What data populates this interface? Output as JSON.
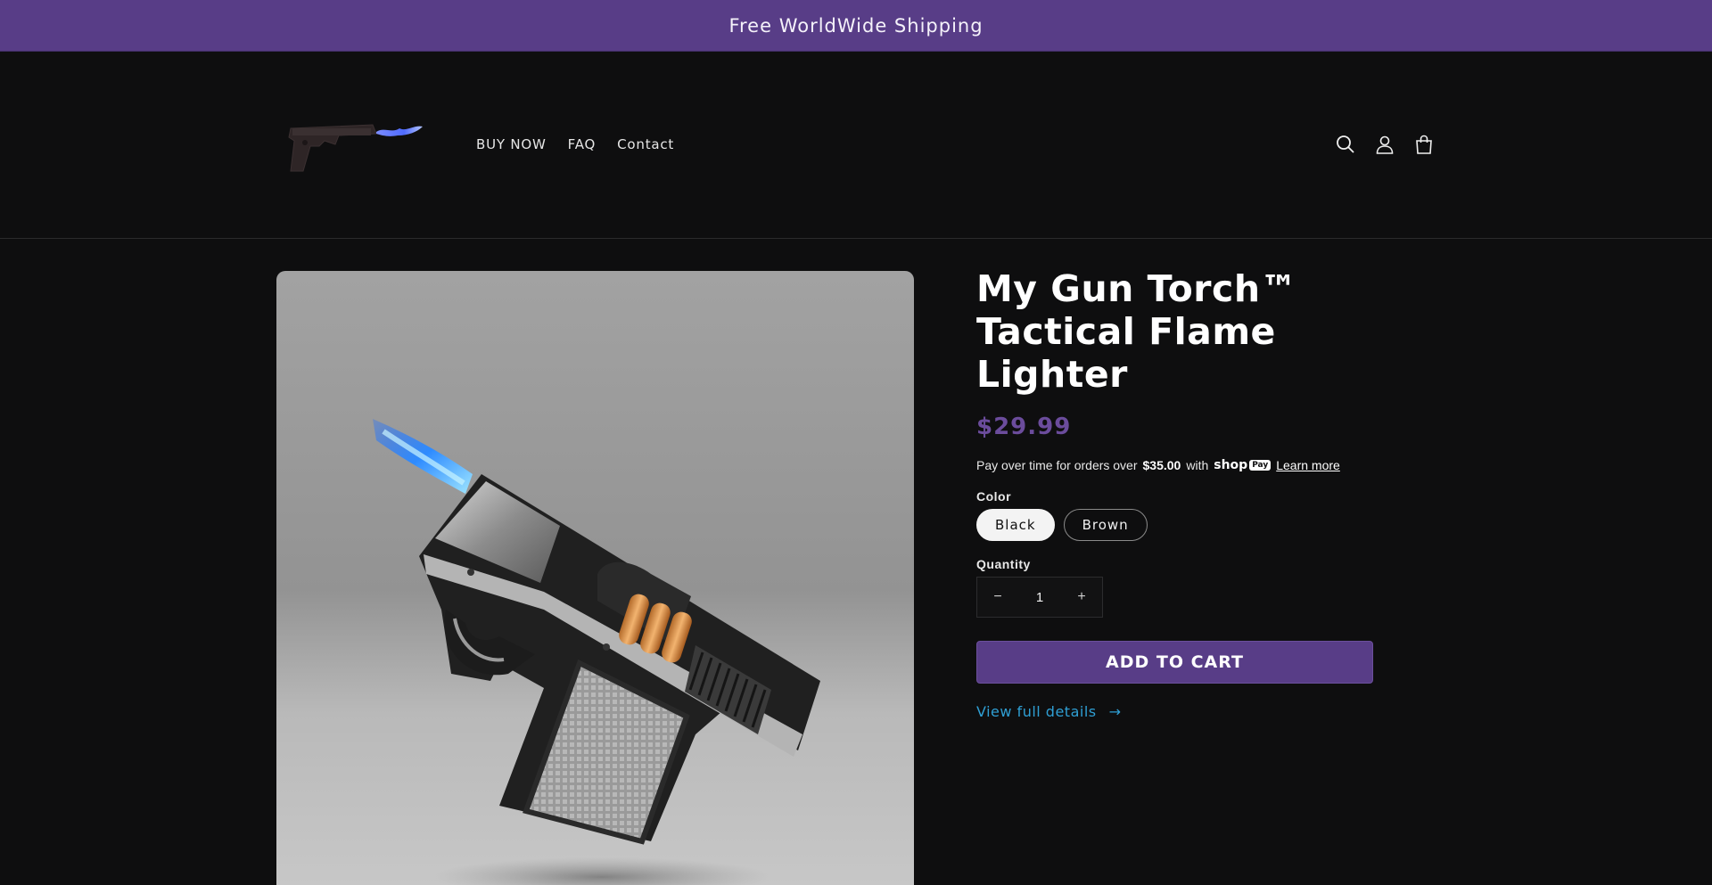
{
  "announcement": {
    "text": "Free WorldWide Shipping"
  },
  "header": {
    "nav": [
      {
        "label": "BUY NOW"
      },
      {
        "label": "FAQ"
      },
      {
        "label": "Contact"
      }
    ],
    "icons": [
      "search-icon",
      "account-icon",
      "cart-icon"
    ]
  },
  "product": {
    "title": "My Gun Torch™ Tactical Flame Lighter",
    "price": "$29.99",
    "installments": {
      "prefix": "Pay over time for orders over",
      "amount": "$35.00",
      "with": "with",
      "brand": "shop",
      "brand_badge": "Pay",
      "learn_more": "Learn more"
    },
    "color": {
      "label": "Color",
      "options": [
        "Black",
        "Brown"
      ],
      "selected": "Black"
    },
    "quantity": {
      "label": "Quantity",
      "value": "1",
      "decrease": "−",
      "increase": "+"
    },
    "add_to_cart": "ADD TO CART",
    "view_details": "View full details",
    "view_details_arrow": "→"
  },
  "colors": {
    "brand": "#583d87",
    "price": "#6b4c9c",
    "link": "#2f9fd4",
    "background": "#0e0e0f"
  }
}
